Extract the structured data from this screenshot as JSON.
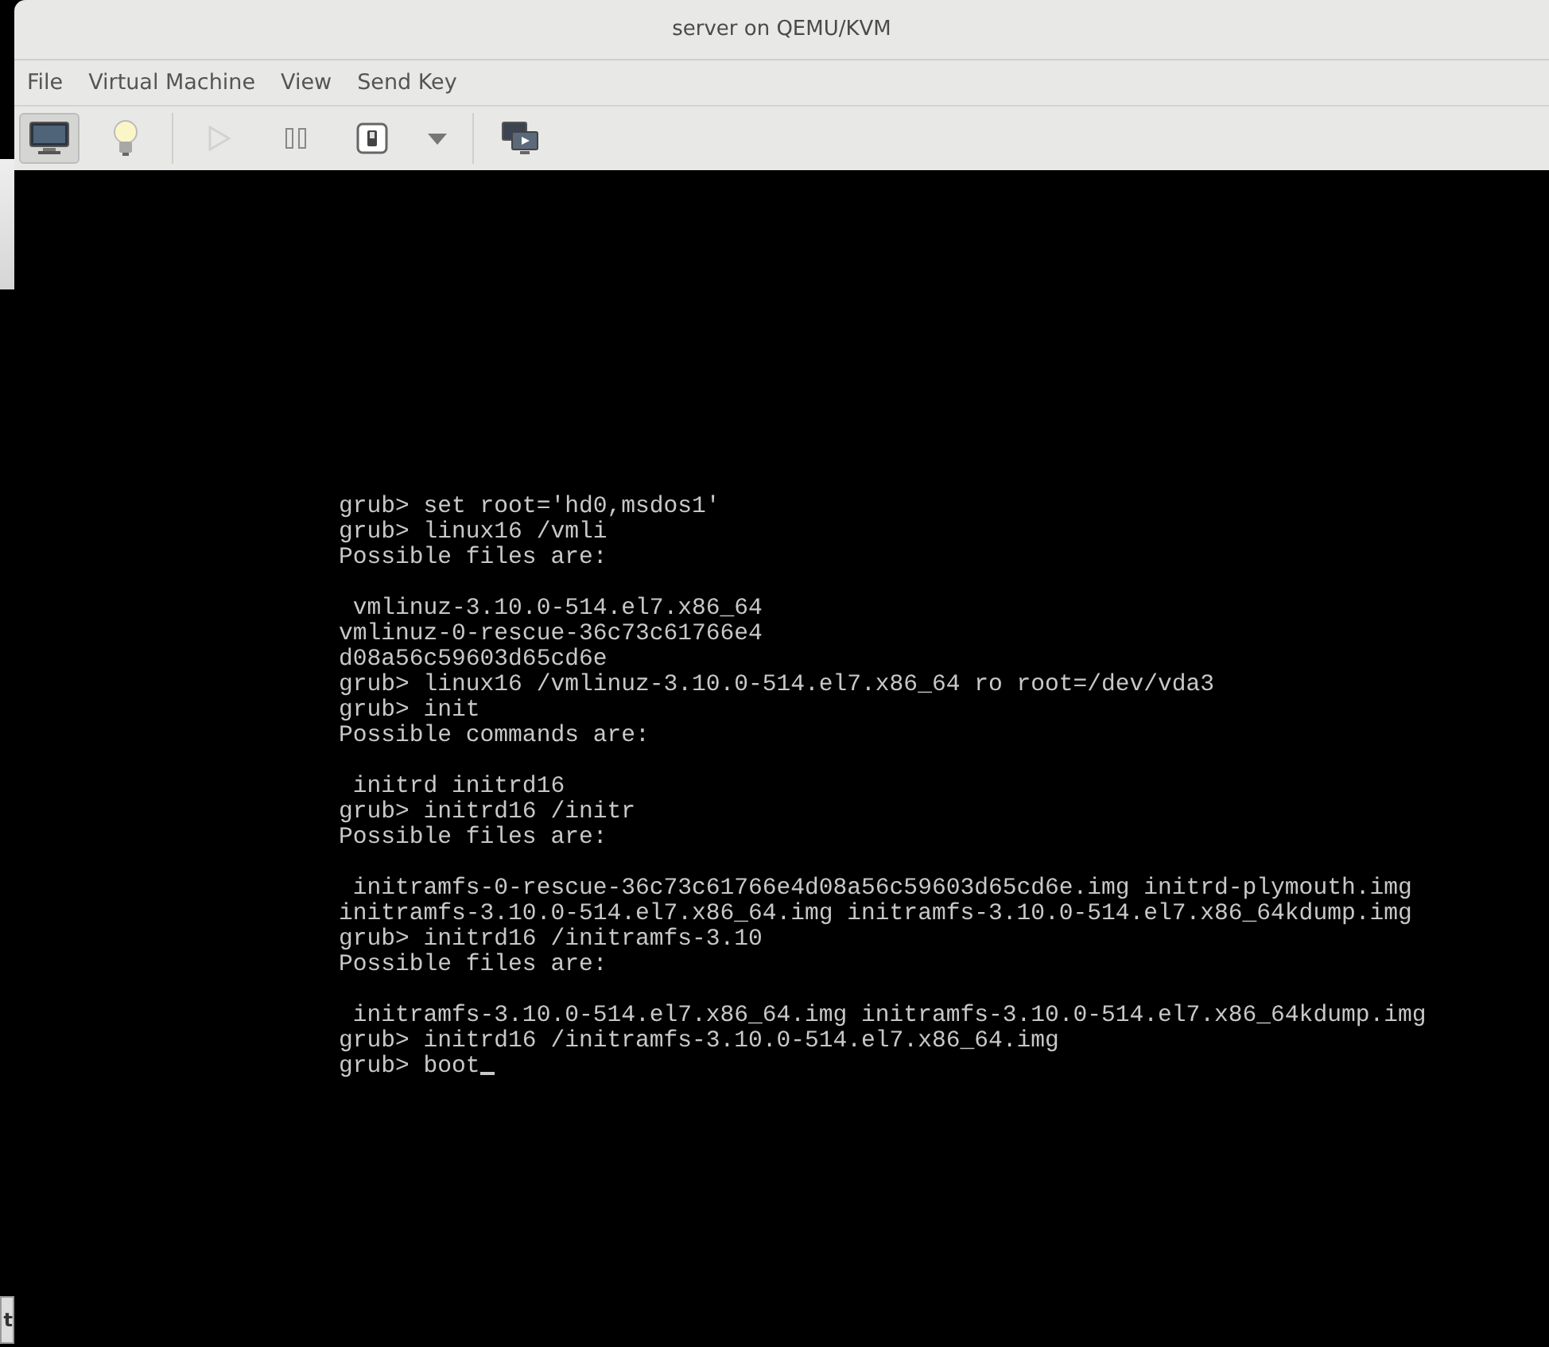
{
  "window": {
    "title": "server on QEMU/KVM"
  },
  "menu": [
    "File",
    "Virtual Machine",
    "View",
    "Send Key"
  ],
  "toolbar": [
    {
      "kind": "monitor",
      "selected": true,
      "disabled": false
    },
    {
      "kind": "bulb",
      "selected": false,
      "disabled": false
    },
    {
      "kind": "separator"
    },
    {
      "kind": "play",
      "selected": false,
      "disabled": true
    },
    {
      "kind": "pause",
      "selected": false,
      "disabled": false
    },
    {
      "kind": "power",
      "selected": false,
      "disabled": false
    },
    {
      "kind": "caret",
      "selected": false,
      "disabled": false
    },
    {
      "kind": "separator"
    },
    {
      "kind": "screens",
      "selected": false,
      "disabled": false
    }
  ],
  "console": {
    "blocks": [
      [
        "grub> set root='hd0,msdos1'",
        "grub> linux16 /vmli",
        "Possible files are:"
      ],
      [
        " vmlinuz-3.10.0-514.el7.x86_64",
        "vmlinuz-0-rescue-36c73c61766e4",
        "d08a56c59603d65cd6e",
        "grub> linux16 /vmlinuz-3.10.0-514.el7.x86_64 ro root=/dev/vda3",
        "grub> init",
        "Possible commands are:"
      ],
      [
        " initrd initrd16",
        "grub> initrd16 /initr",
        "Possible files are:"
      ],
      [
        " initramfs-0-rescue-36c73c61766e4d08a56c59603d65cd6e.img initrd-plymouth.img",
        "initramfs-3.10.0-514.el7.x86_64.img initramfs-3.10.0-514.el7.x86_64kdump.img",
        "grub> initrd16 /initramfs-3.10",
        "Possible files are:"
      ],
      [
        " initramfs-3.10.0-514.el7.x86_64.img initramfs-3.10.0-514.el7.x86_64kdump.img",
        "grub> initrd16 /initramfs-3.10.0-514.el7.x86_64.img",
        "grub> boot"
      ]
    ],
    "cursor": true
  },
  "background_window": {
    "button_fragment": "t"
  }
}
